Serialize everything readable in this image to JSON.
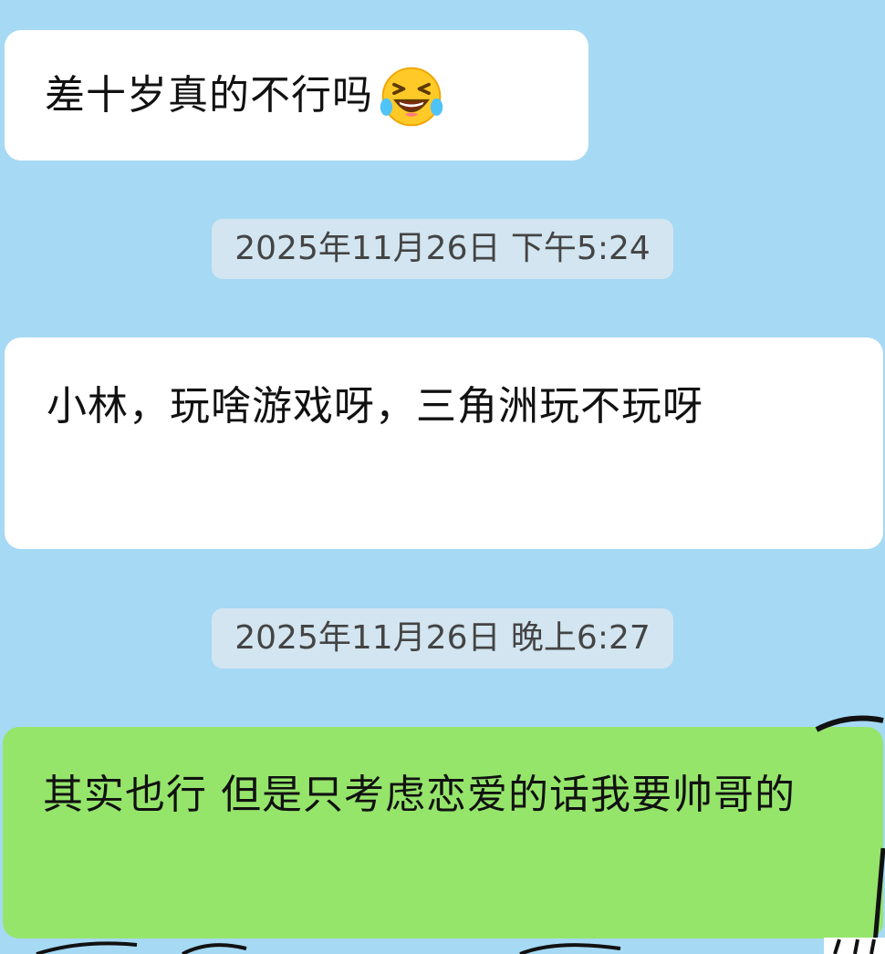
{
  "messages": [
    {
      "side": "incoming",
      "text": "差十岁真的不行吗",
      "emoji": "laughing-tears-emoji"
    },
    {
      "side": "incoming",
      "text": "小林，玩啥游戏呀，三角洲玩不玩呀"
    },
    {
      "side": "outgoing",
      "text": "其实也行 但是只考虑恋爱的话我要帅哥的"
    }
  ],
  "timestamps": [
    "2025年11月26日 下午5:24",
    "2025年11月26日 晚上6:27"
  ],
  "colors": {
    "background": "#a6d9f4",
    "incoming_bubble": "#ffffff",
    "outgoing_bubble": "#95e56b",
    "timestamp_pill": "#d2e5f0"
  }
}
